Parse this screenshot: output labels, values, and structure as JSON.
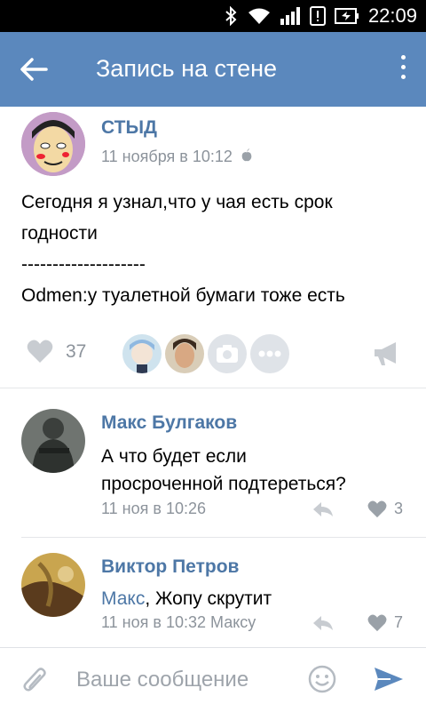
{
  "status_bar": {
    "time": "22:09"
  },
  "toolbar": {
    "title": "Запись на стене"
  },
  "post": {
    "author": "СТЫД",
    "date": "11 ноября в 10:12",
    "text_line1": "Сегодня я узнал,что у чая есть срок",
    "text_line2": "годности",
    "text_line3": "--------------------",
    "text_line4": "Odmen:у туалетной бумаги тоже есть",
    "likes": "37"
  },
  "comments": [
    {
      "author": "Макс Булгаков",
      "line1": "А что будет если",
      "line2": "просроченной подтереться?",
      "date": "11 ноя в 10:26",
      "likes": "3"
    },
    {
      "author": "Виктор Петров",
      "mention": "Макс",
      "text": ", Жопу скрутит",
      "date": "11 ноя в 10:32 Максу",
      "likes": "7"
    }
  ],
  "composer": {
    "placeholder": "Ваше сообщение"
  },
  "colors": {
    "accent": "#5b88bd",
    "link": "#4d77a6",
    "muted": "#8c939b"
  }
}
